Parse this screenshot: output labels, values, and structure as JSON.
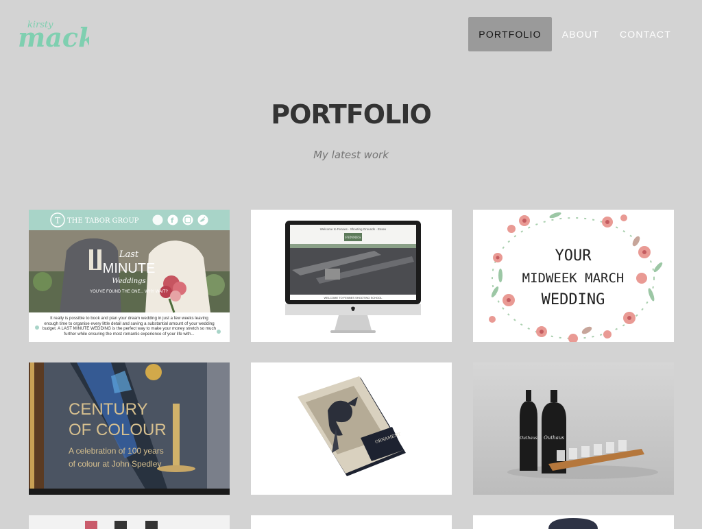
{
  "brand": {
    "logo_small": "kirsty",
    "logo_large": "mack"
  },
  "nav": {
    "items": [
      {
        "label": "PORTFOLIO",
        "active": true
      },
      {
        "label": "ABOUT",
        "active": false
      },
      {
        "label": "CONTACT",
        "active": false
      }
    ]
  },
  "page": {
    "title": "PORTFOLIO",
    "subtitle": "My latest work"
  },
  "portfolio": {
    "tiles": [
      {
        "brand": "THE TABOR GROUP",
        "headline_top": "Last",
        "headline_main": "MINUTE",
        "headline_bottom": "Weddings",
        "tagline": "YOU'VE FOUND THE ONE... WHY WAIT?",
        "body": "It really is possible to book and plan your dream wedding in just a few weeks leaving enough time to organise every little detail and saving a substantial amount of your wedding budget. A LAST MINUTE WEDDING is the perfect way to make your money stretch so much further while ensuring the most romantic experience of your life with..."
      },
      {
        "site_name": "FENNES",
        "site_header": "Welcome to Fennes · Shooting Grounds · Essex",
        "site_banner": "WELCOME TO FENNES SHOOTING SCHOOL"
      },
      {
        "line1": "YOUR",
        "line2": "MIDWEEK MARCH",
        "line3": "WEDDING"
      },
      {
        "line1": "CENTURY",
        "line2": "OF COLOUR",
        "line3": "A celebration of 100 years",
        "line4": "of colour at John Spedley"
      },
      {
        "cover_title": "ORNAMENT"
      },
      {
        "bottle_label": "Outhaus"
      },
      {},
      {},
      {}
    ]
  },
  "colors": {
    "background": "#d3d3d3",
    "logo_mint": "#7fcfb0",
    "nav_active": "#9a9a9a",
    "tabor_mint": "#a8d4c8",
    "wreath_pink": "#e99a94",
    "wreath_green": "#9cc7a5"
  }
}
